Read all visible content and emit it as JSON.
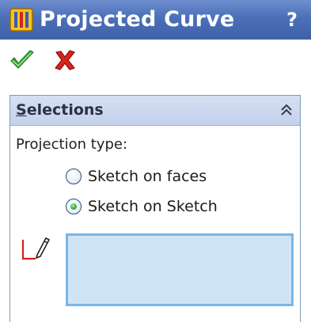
{
  "title": "Projected Curve",
  "help_label": "?",
  "icons": {
    "feature": "projected-curve-icon",
    "ok": "checkmark-icon",
    "cancel": "x-icon",
    "collapse": "double-chevron-up-icon",
    "selection": "sketch-selection-icon"
  },
  "colors": {
    "titlebar": "#4b6fb8",
    "group_header": "#c8d6ef",
    "selection_box": "#cfe5f7",
    "selection_border": "#79b6e8",
    "ok": "#2fa82f",
    "cancel": "#d4201a"
  },
  "group": {
    "title_mnemonic": "S",
    "title_rest": "elections",
    "projection_label": "Projection type:",
    "options": [
      {
        "label": "Sketch on faces",
        "selected": false
      },
      {
        "label": "Sketch on Sketch",
        "selected": true
      }
    ]
  }
}
